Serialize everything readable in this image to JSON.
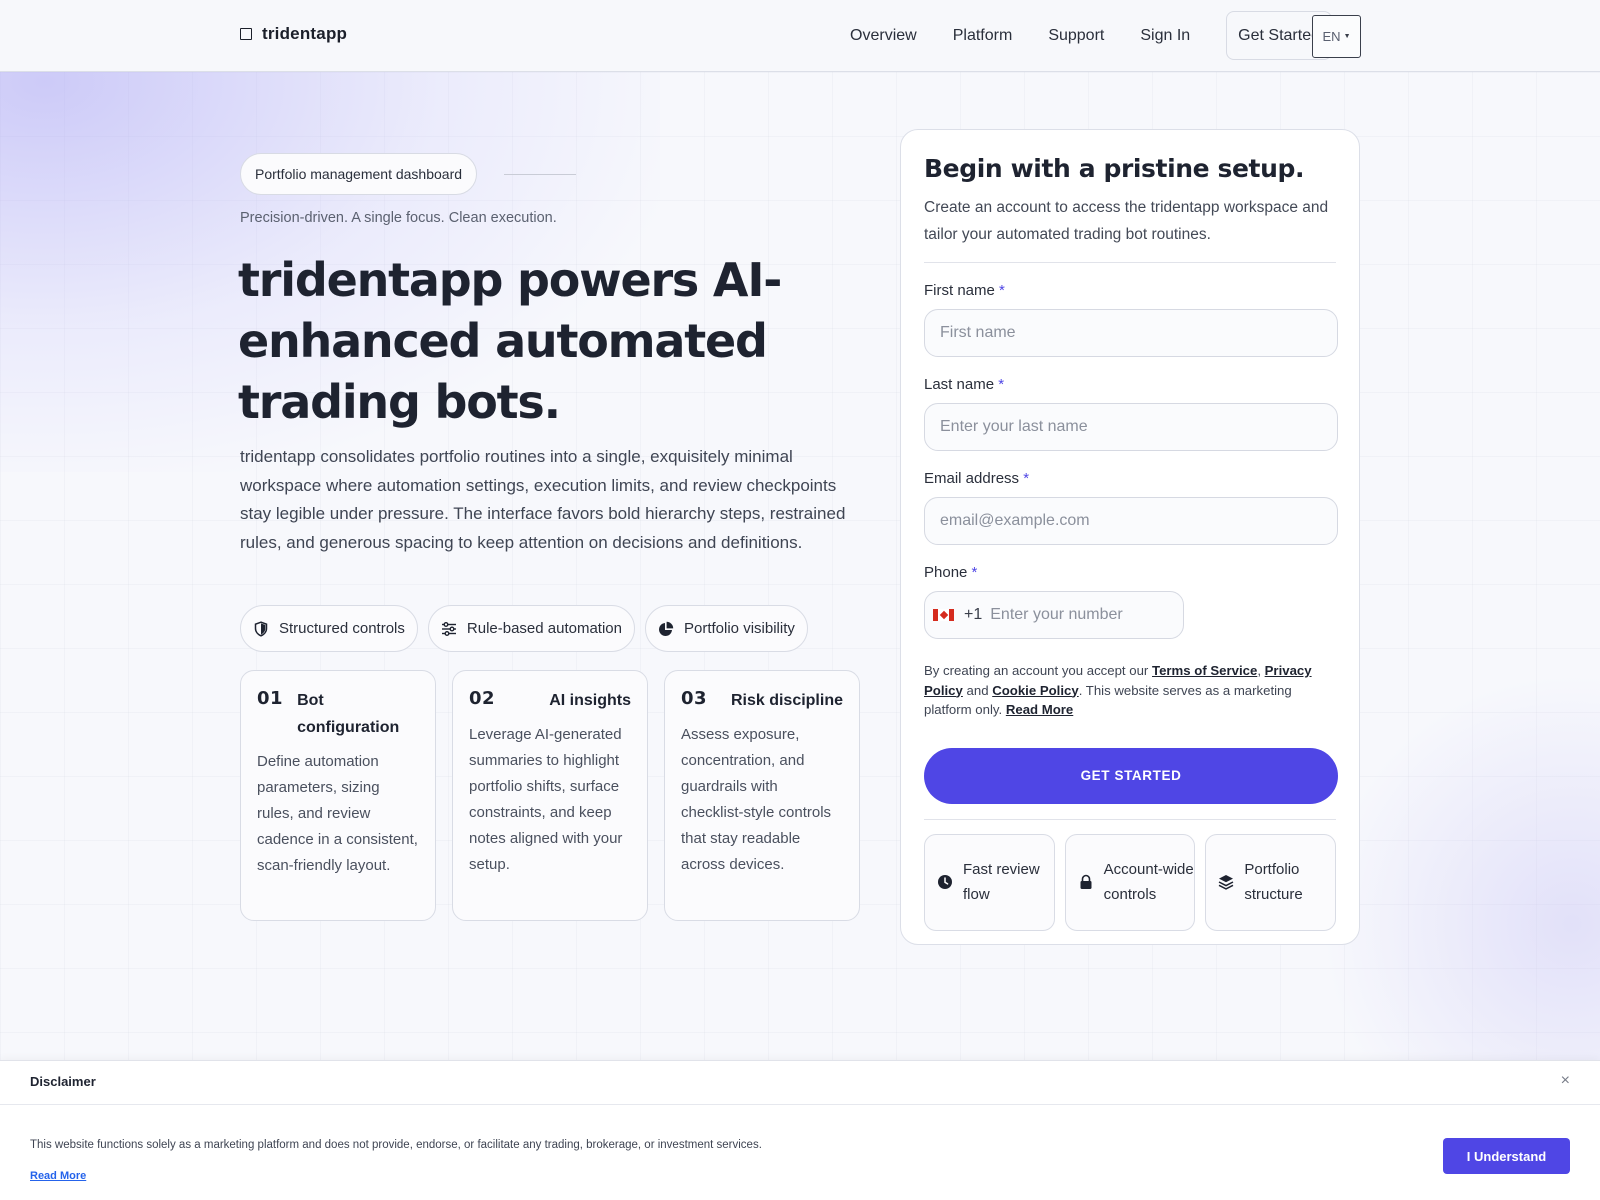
{
  "header": {
    "logo": "tridentapp",
    "nav": [
      "Overview",
      "Platform",
      "Support",
      "Sign In"
    ],
    "cta": "Get Started",
    "lang": "EN"
  },
  "hero": {
    "tag": "Portfolio management dashboard",
    "tagline": "Precision-driven. A single focus. Clean execution.",
    "title": "tridentapp powers AI-enhanced automated trading bots.",
    "description": "tridentapp consolidates portfolio routines into a single, exquisitely minimal workspace where automation settings, execution limits, and review checkpoints stay legible under pressure. The interface favors bold hierarchy steps, restrained rules, and generous spacing to keep attention on decisions and definitions.",
    "chips": [
      {
        "icon": "shield-icon",
        "label": "Structured controls"
      },
      {
        "icon": "sliders-icon",
        "label": "Rule-based automation"
      },
      {
        "icon": "pie-chart-icon",
        "label": "Portfolio visibility"
      }
    ],
    "cards": [
      {
        "num": "01",
        "title": "Bot configuration",
        "body": "Define automation parameters, sizing rules, and review cadence in a consistent, scan-friendly layout."
      },
      {
        "num": "02",
        "title": "AI insights",
        "body": "Leverage AI-generated summaries to highlight portfolio shifts, surface constraints, and keep notes aligned with your setup."
      },
      {
        "num": "03",
        "title": "Risk discipline",
        "body": "Assess exposure, concentration, and guardrails with checklist-style controls that stay readable across devices."
      }
    ]
  },
  "form": {
    "title": "Begin with a pristine setup.",
    "subtitle": "Create an account to access the tridentapp workspace and tailor your automated trading bot routines.",
    "required_mark": "*",
    "first_name": {
      "label": "First name",
      "placeholder": "First name"
    },
    "last_name": {
      "label": "Last name",
      "placeholder": "Enter your last name"
    },
    "email": {
      "label": "Email address",
      "placeholder": "email@example.com"
    },
    "phone": {
      "label": "Phone",
      "code": "+1",
      "placeholder": "Enter your number"
    },
    "legal": {
      "prefix": "By creating an account you accept our ",
      "terms": "Terms of Service",
      "sep1": ", ",
      "privacy": "Privacy Policy",
      "sep2": " and ",
      "cookie": "Cookie Policy",
      "suffix": ". This website serves as a marketing platform only. ",
      "read_more": "Read More"
    },
    "submit": "GET STARTED",
    "features": [
      {
        "icon": "clock-icon",
        "label": "Fast review flow"
      },
      {
        "icon": "lock-icon",
        "label": "Account-wide controls"
      },
      {
        "icon": "layers-icon",
        "label": "Portfolio structure"
      }
    ]
  },
  "disclaimer": {
    "title": "Disclaimer",
    "close": "×",
    "text": "This website functions solely as a marketing platform and does not provide, endorse, or facilitate any trading, brokerage, or investment services.",
    "read_more": "Read More",
    "button": "I Understand"
  },
  "colors": {
    "accent": "#4f46e5",
    "text": "#1e2330",
    "link": "#2563eb"
  }
}
